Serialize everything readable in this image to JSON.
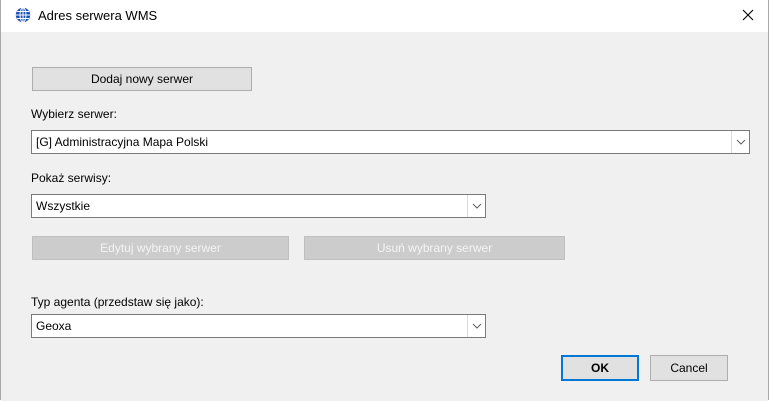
{
  "window": {
    "title": "Adres serwera WMS",
    "icon": "globe-icon",
    "close_icon": "close-icon"
  },
  "buttons": {
    "add_server": "Dodaj nowy serwer",
    "edit_server": "Edytuj wybrany serwer",
    "remove_server": "Usuń wybrany serwer",
    "ok": "OK",
    "cancel": "Cancel"
  },
  "fields": {
    "server": {
      "label": "Wybierz serwer:",
      "value": "[G] Administracyjna Mapa Polski"
    },
    "show_services": {
      "label": "Pokaż serwisy:",
      "value": "Wszystkie"
    },
    "agent_type": {
      "label": "Typ agenta (przedstaw się jako):",
      "value": "Geoxa"
    }
  },
  "colors": {
    "accent": "#0078d7",
    "client_bg": "#f0f0f0",
    "button_bg": "#e1e1e1",
    "disabled_button_bg": "#cccccc"
  }
}
